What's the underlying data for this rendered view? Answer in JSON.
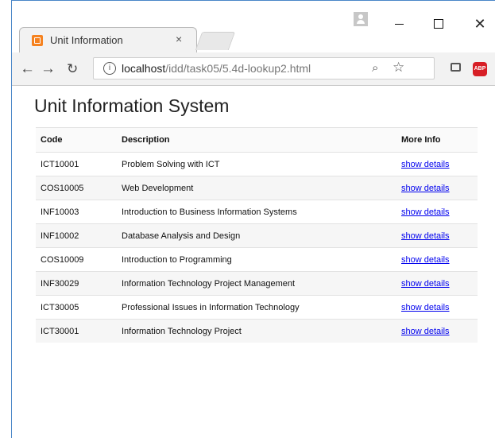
{
  "browser": {
    "tab_title": "Unit Information",
    "tab_close": "×",
    "url_host": "localhost",
    "url_path": "/idd/task05/5.4d-lookup2.html",
    "window_close": "✕",
    "icons": [
      "back-icon",
      "forward-icon",
      "reload-icon",
      "info-icon",
      "zoom-icon",
      "star-icon",
      "cast-icon",
      "adblock-icon",
      "menu-icon"
    ]
  },
  "page": {
    "title": "Unit Information System",
    "columns": [
      "Code",
      "Description",
      "More Info"
    ],
    "link_label": "show details",
    "rows": [
      {
        "code": "ICT10001",
        "description": "Problem Solving with ICT",
        "info": "show details"
      },
      {
        "code": "COS10005",
        "description": "Web Development",
        "info": "show details"
      },
      {
        "code": "INF10003",
        "description": "Introduction to Business Information Systems",
        "info": "show details"
      },
      {
        "code": "INF10002",
        "description": "Database Analysis and Design",
        "info": "show details"
      },
      {
        "code": "COS10009",
        "description": "Introduction to Programming",
        "info": "show details"
      },
      {
        "code": "INF30029",
        "description": "Information Technology Project Management",
        "info": "show details"
      },
      {
        "code": "ICT30005",
        "description": "Professional Issues in Information Technology",
        "info": "show details"
      },
      {
        "code": "ICT30001",
        "description": "Information Technology Project",
        "info": "show details"
      }
    ]
  }
}
